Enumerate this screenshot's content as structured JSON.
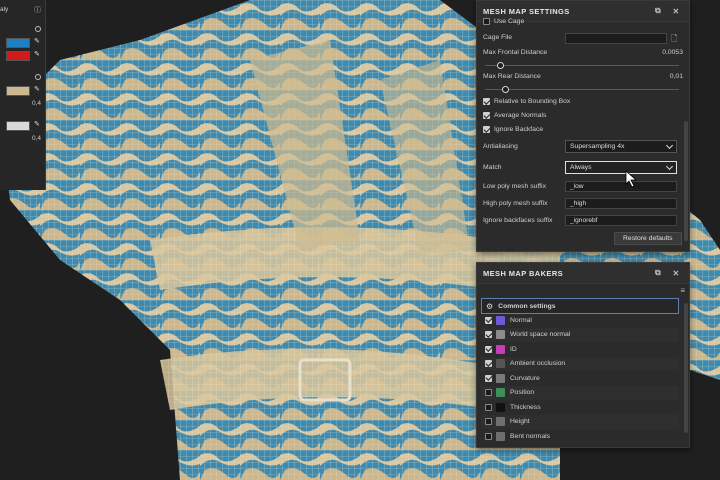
{
  "left_panel": {
    "top_label": "aly",
    "values": [
      "0,4",
      "0,4"
    ],
    "colors": {
      "blue": "#1e7fc2",
      "red": "#d11a1a",
      "tan": "#cdb78c",
      "light": "#d9d9d9"
    }
  },
  "mesh_map_settings": {
    "title": "MESH MAP SETTINGS",
    "use_cage": {
      "label": "Use Cage",
      "checked": false
    },
    "cage_file": {
      "label": "Cage File",
      "value": ""
    },
    "max_frontal_distance": {
      "label": "Max Frontal Distance",
      "value": "0,0053",
      "fraction": 0.05
    },
    "max_rear_distance": {
      "label": "Max Rear Distance",
      "value": "0,01",
      "fraction": 0.1
    },
    "relative_to_bbox": {
      "label": "Relative to Bounding Box",
      "checked": true
    },
    "average_normals": {
      "label": "Average Normals",
      "checked": true
    },
    "ignore_backface": {
      "label": "Ignore Backface",
      "checked": true
    },
    "antialiasing": {
      "label": "Antialiasing",
      "value": "Supersampling 4x"
    },
    "match": {
      "label": "Match",
      "value": "Always"
    },
    "low_poly_suffix": {
      "label": "Low poly mesh suffix",
      "value": "_low"
    },
    "high_poly_suffix": {
      "label": "High poly mesh suffix",
      "value": "_high"
    },
    "ignore_backfaces_suffix": {
      "label": "Ignore backfaces suffix",
      "value": "_ignorebf"
    },
    "restore_defaults": "Restore defaults"
  },
  "mesh_map_bakers": {
    "title": "MESH MAP BAKERS",
    "common_settings": "Common settings",
    "items": [
      {
        "label": "Normal",
        "checked": true,
        "color": "#6a5bd8",
        "icon": "normal-map-icon"
      },
      {
        "label": "World space normal",
        "checked": true,
        "color": "#8c8c8c",
        "icon": "world-normal-icon"
      },
      {
        "label": "ID",
        "checked": true,
        "color": "#c43fb7",
        "icon": "id-map-icon"
      },
      {
        "label": "Ambient occlusion",
        "checked": true,
        "color": "#555555",
        "icon": "ao-map-icon"
      },
      {
        "label": "Curvature",
        "checked": true,
        "color": "#7a7a7a",
        "icon": "curvature-map-icon"
      },
      {
        "label": "Position",
        "checked": false,
        "color": "#3e8f5a",
        "icon": "position-map-icon"
      },
      {
        "label": "Thickness",
        "checked": false,
        "color": "#111111",
        "icon": "thickness-map-icon"
      },
      {
        "label": "Height",
        "checked": false,
        "color": "#6f6f6f",
        "icon": "height-map-icon"
      },
      {
        "label": "Bent normals",
        "checked": false,
        "color": "#6f6f6f",
        "icon": "bent-normals-icon"
      }
    ]
  }
}
